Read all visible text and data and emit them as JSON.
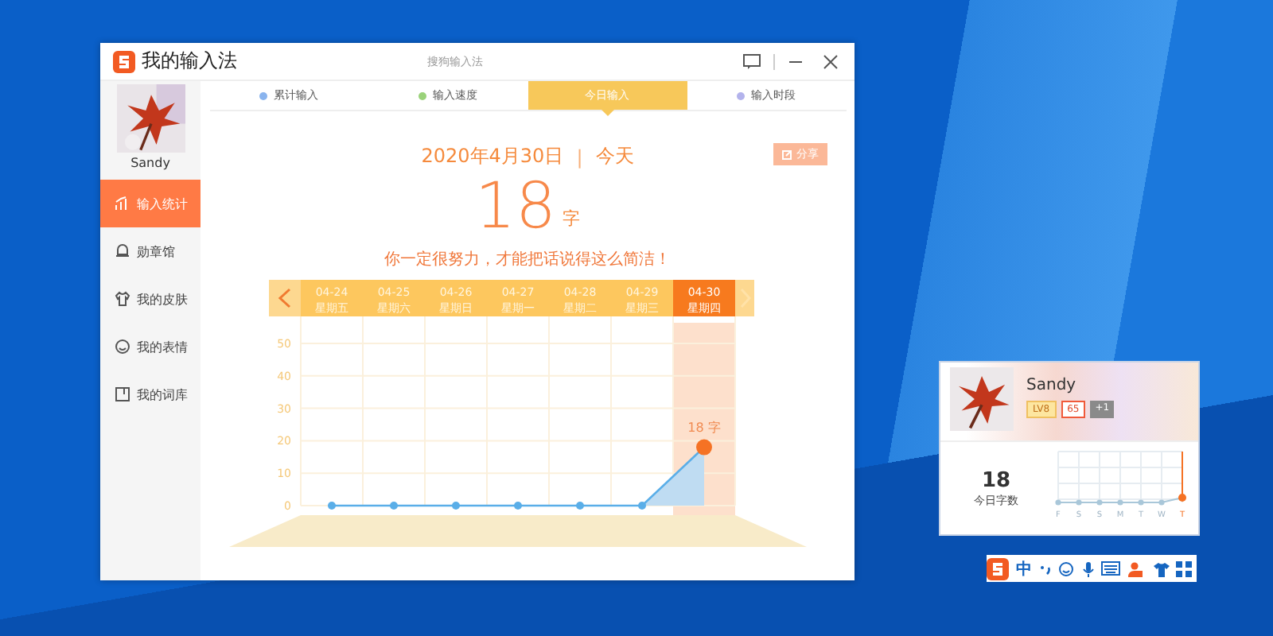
{
  "window": {
    "title": "我的输入法",
    "subtitle": "搜狗输入法"
  },
  "sidebar": {
    "user": {
      "name": "Sandy"
    },
    "items": [
      {
        "label": "输入统计",
        "selected": true
      },
      {
        "label": "勋章馆",
        "selected": false
      },
      {
        "label": "我的皮肤",
        "selected": false
      },
      {
        "label": "我的表情",
        "selected": false
      },
      {
        "label": "我的词库",
        "selected": false
      }
    ]
  },
  "tabs": [
    {
      "label": "累计输入",
      "color": "#8ab4ee",
      "selected": false
    },
    {
      "label": "输入速度",
      "color": "#9ad27a",
      "selected": false
    },
    {
      "label": "今日输入",
      "color": "#f7c85a",
      "selected": true
    },
    {
      "label": "输入时段",
      "color": "#b3b3ec",
      "selected": false
    }
  ],
  "summary": {
    "date": "2020年4月30日",
    "separator": "|",
    "day": "今天",
    "share": "分享",
    "count": "18",
    "unit": "字",
    "message": "你一定很努力，才能把话说得这么简洁！"
  },
  "days": [
    {
      "weekday": "星期五",
      "selected": false
    },
    {
      "weekday": "星期六",
      "selected": false
    },
    {
      "weekday": "星期日",
      "selected": false
    },
    {
      "weekday": "星期一",
      "selected": false
    },
    {
      "weekday": "星期二",
      "selected": false
    },
    {
      "weekday": "星期三",
      "selected": false
    },
    {
      "weekday": "星期四",
      "selected": true
    }
  ],
  "chart": {
    "chart_data": {
      "type": "area",
      "categories": [
        "04-24",
        "04-25",
        "04-26",
        "04-27",
        "04-28",
        "04-29",
        "04-30"
      ],
      "series": [
        {
          "color": "#5aaee8",
          "values": [
            0,
            0,
            0,
            0,
            0,
            0,
            18
          ]
        }
      ],
      "ylim": [
        0,
        50
      ],
      "yticks": [
        0,
        10,
        20,
        30,
        40,
        50
      ],
      "grid": true,
      "annotations": [
        "18 字"
      ]
    }
  },
  "card": {
    "name": "Sandy",
    "badges": [
      "LV8",
      "65",
      "+1"
    ],
    "count": "18",
    "count_label": "今日字数",
    "mini_labels": [
      "F",
      "S",
      "S",
      "M",
      "T",
      "W",
      "T"
    ]
  },
  "tray": {
    "mode": "中"
  }
}
